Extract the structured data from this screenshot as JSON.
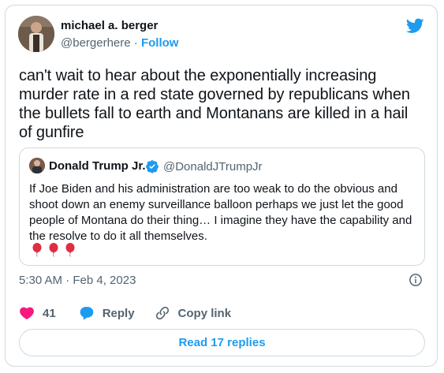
{
  "author": {
    "name": "michael a. berger",
    "handle": "@bergerhere",
    "separator": "·",
    "follow_label": "Follow"
  },
  "tweet": {
    "text": "can't wait to hear about the exponentially increasing murder rate in a red state governed by republicans when the bullets fall to earth and Montanans are killed in a hail of gunfire",
    "timestamp": "5:30 AM · Feb 4, 2023"
  },
  "quoted_tweet": {
    "name": "Donald Trump Jr.",
    "handle": "@DonaldJTrumpJr",
    "verified": true,
    "text": "If Joe Biden and his administration are too weak to do the obvious and shoot down an enemy surveillance balloon perhaps we just let the good people of Montana do their thing… I imagine they have the capability and the resolve to do it all themselves.",
    "emoji": [
      "balloon",
      "balloon",
      "balloon"
    ]
  },
  "actions": {
    "like_count": "41",
    "reply_label": "Reply",
    "copy_link_label": "Copy link"
  },
  "footer": {
    "read_replies_label": "Read 17 replies"
  },
  "colors": {
    "accent": "#1d9bf0",
    "like": "#f91880",
    "muted": "#536471",
    "border": "#cfd9de"
  },
  "icons": [
    "twitter-bird-icon",
    "verified-badge-icon",
    "info-icon",
    "heart-icon",
    "reply-bubble-icon",
    "link-icon",
    "balloon-emoji"
  ]
}
